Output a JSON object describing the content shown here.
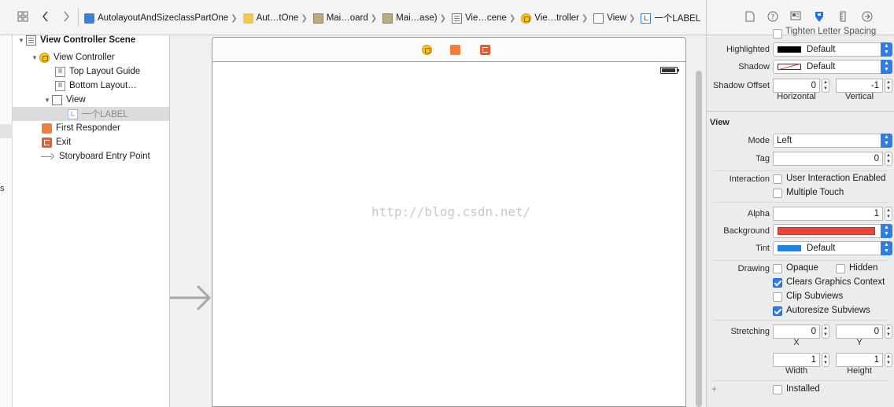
{
  "breadcrumbs": [
    {
      "label": "AutolayoutAndSizeclassPartOne",
      "icon": "project-icon"
    },
    {
      "label": "Aut…tOne",
      "icon": "folder-icon"
    },
    {
      "label": "Mai…oard",
      "icon": "storyboard-file-icon"
    },
    {
      "label": "Mai…ase)",
      "icon": "storyboard-file-icon"
    },
    {
      "label": "Vie…cene",
      "icon": "scene-icon"
    },
    {
      "label": "Vie…troller",
      "icon": "view-controller-icon"
    },
    {
      "label": "View",
      "icon": "view-icon"
    },
    {
      "label": "一个LABEL",
      "icon": "label-icon"
    }
  ],
  "outline": {
    "scene": "View Controller Scene",
    "view_controller": "View Controller",
    "top_guide": "Top Layout Guide",
    "bottom_guide": "Bottom Layout…",
    "view": "View",
    "label": "一个LABEL",
    "first_responder": "First Responder",
    "exit": "Exit",
    "entry_point": "Storyboard Entry Point"
  },
  "left_edge_text": "s",
  "canvas": {
    "watermark": "http://blog.csdn.net/"
  },
  "inspector": {
    "top_cut_text": "Tighten Letter Spacing",
    "highlighted_label": "Highlighted",
    "highlighted_value": "Default",
    "shadow_label": "Shadow",
    "shadow_value": "Default",
    "shadow_offset_label": "Shadow Offset",
    "shadow_offset_h": "0",
    "shadow_offset_v": "-1",
    "horizontal_label": "Horizontal",
    "vertical_label": "Vertical",
    "view_section": "View",
    "mode_label": "Mode",
    "mode_value": "Left",
    "tag_label": "Tag",
    "tag_value": "0",
    "interaction_label": "Interaction",
    "user_interaction": "User Interaction Enabled",
    "multiple_touch": "Multiple Touch",
    "alpha_label": "Alpha",
    "alpha_value": "1",
    "background_label": "Background",
    "tint_label": "Tint",
    "tint_value": "Default",
    "drawing_label": "Drawing",
    "opaque": "Opaque",
    "hidden": "Hidden",
    "clears_graphics": "Clears Graphics Context",
    "clip_subviews": "Clip Subviews",
    "autoresize_subviews": "Autoresize Subviews",
    "stretching_label": "Stretching",
    "stretch_x": "0",
    "stretch_y": "0",
    "x_label": "X",
    "y_label": "Y",
    "stretch_w": "1",
    "stretch_h": "1",
    "width_label": "Width",
    "height_label": "Height",
    "plus": "+",
    "installed": "Installed"
  },
  "colors": {
    "background_swatch": "#e8463a",
    "tint_swatch": "#1a84e8",
    "highlighted_swatch": "#000000",
    "accent": "#2f7de1"
  }
}
